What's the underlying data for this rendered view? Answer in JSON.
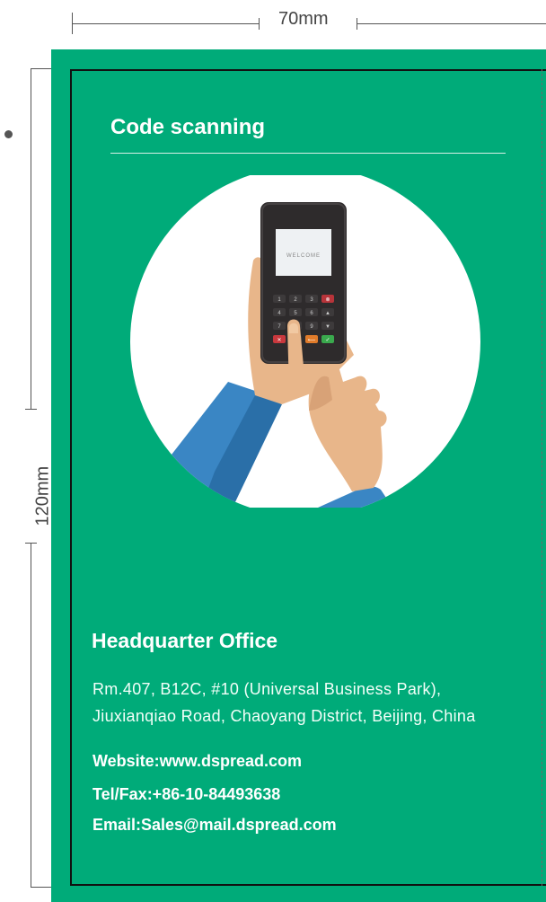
{
  "dimensions": {
    "width_label": "70mm",
    "height_label": "120mm"
  },
  "card": {
    "title": "Code scanning",
    "device_screen_text": "WELCOME",
    "keypad_keys": [
      "1",
      "2",
      "3",
      "⊗",
      "4",
      "5",
      "6",
      "▲",
      "7",
      "8",
      "9",
      "▼",
      "✕",
      "0",
      "⟵",
      "✓"
    ],
    "headquarter": {
      "title": "Headquarter Office",
      "address_line1": "Rm.407, B12C,  #10 (Universal Business Park),",
      "address_line2": "Jiuxianqiao Road, Chaoyang District, Beijing, China"
    },
    "website": "Website:www.dspread.com",
    "tel_fax": "Tel/Fax:+86-10-84493638",
    "email": "Email:Sales@mail.dspread.com"
  },
  "colors": {
    "card_background": "#00ab79",
    "text": "#ffffff",
    "sleeve": "#3a86c4",
    "skin": "#e8b68a",
    "device": "#2e2b2c"
  }
}
